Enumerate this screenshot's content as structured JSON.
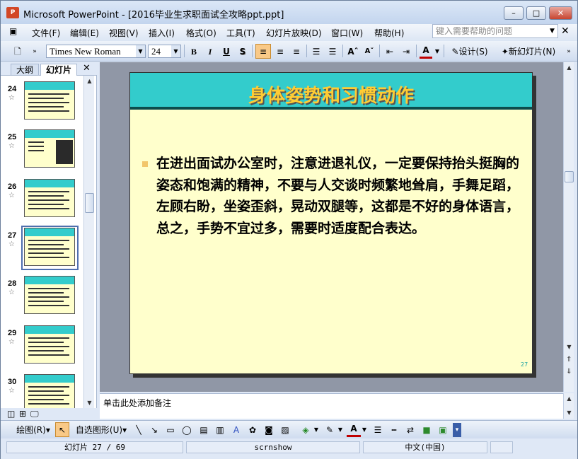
{
  "window": {
    "title": "Microsoft PowerPoint - [2016毕业生求职面试全攻略ppt.ppt]",
    "app_icon": "P"
  },
  "menu": [
    "文件(F)",
    "编辑(E)",
    "视图(V)",
    "插入(I)",
    "格式(O)",
    "工具(T)",
    "幻灯片放映(D)",
    "窗口(W)",
    "帮助(H)"
  ],
  "help": {
    "placeholder": "键入需要帮助的问题"
  },
  "toolbar": {
    "font": "Times New Roman",
    "size": "24",
    "bold": "B",
    "italic": "I",
    "underline": "U",
    "shadow": "S",
    "design": "设计(S)",
    "new_slide": "新幻灯片(N)",
    "grow": "A",
    "shrink": "A",
    "font_color": "A"
  },
  "tabs": {
    "outline": "大纲",
    "slides": "幻灯片"
  },
  "thumbnails": [
    {
      "num": "24"
    },
    {
      "num": "25"
    },
    {
      "num": "26"
    },
    {
      "num": "27"
    },
    {
      "num": "28"
    },
    {
      "num": "29"
    },
    {
      "num": "30"
    }
  ],
  "slide": {
    "title": "身体姿势和习惯动作",
    "body": "在进出面试办公室时，注意进退礼仪，一定要保持抬头挺胸的姿态和饱满的精神，不要与人交谈时频繁地耸肩，手舞足蹈，左顾右盼，坐姿歪斜，晃动双腿等，这都是不好的身体语言，总之，手势不宜过多，需要时适度配合表达。",
    "page": "27"
  },
  "notes": {
    "placeholder": "单击此处添加备注"
  },
  "drawing": {
    "draw": "绘图(R)",
    "autoshape": "自选图形(U)"
  },
  "status": {
    "slide": "幻灯片 27 / 69",
    "design": "scrnshow",
    "lang": "中文(中国)"
  },
  "colors": {
    "title_bar": "#33cccc",
    "title_text": "#ffcc33",
    "slide_bg": "#ffffcc"
  }
}
